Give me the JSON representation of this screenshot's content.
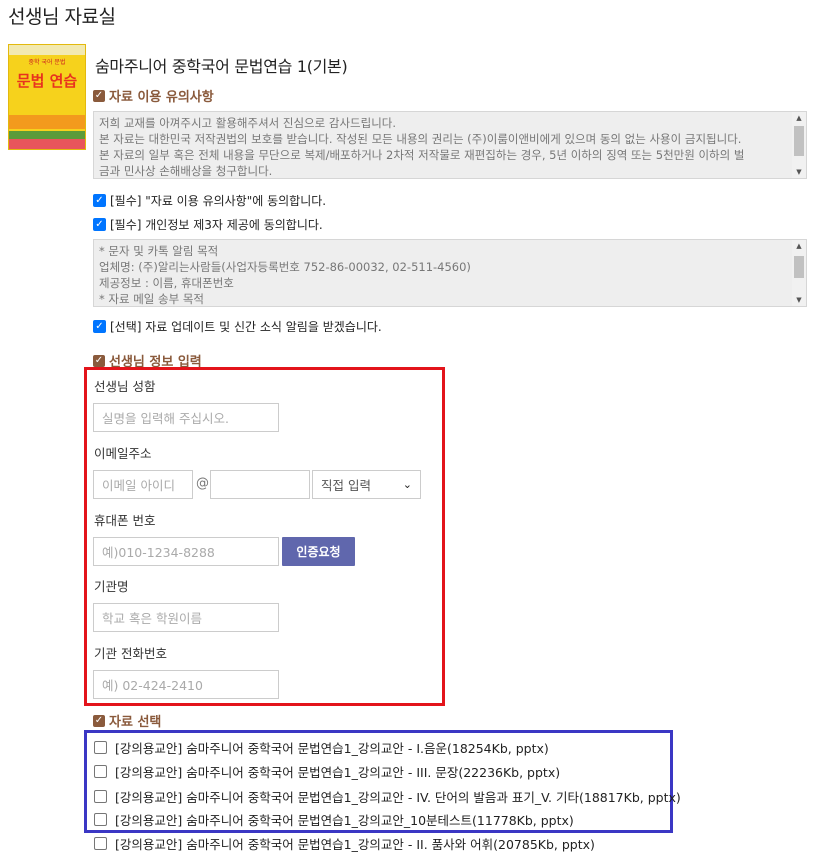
{
  "page": {
    "title": "선생님 자료실"
  },
  "book": {
    "title": "숨마주니어 중학국어 문법연습 1(기본)",
    "cover_top_text": "중학 국어 문법",
    "cover_line": "문법 연습"
  },
  "notice": {
    "header": "자료 이용 유의사항",
    "lines": [
      "저희 교재를 아껴주시고 활용해주셔서 진심으로 감사드립니다.",
      "본 자료는 대한민국 저작권법의 보호를 받습니다. 작성된 모든 내용의 권리는 (주)이룸이앤비에게 있으며 동의 없는 사용이 금지됩니다.",
      "본 자료의 일부 혹은 전체 내용을 무단으로 복제/배포하거나 2차적 저작물로 재편집하는 경우, 5년 이하의 징역 또는 5천만원 이하의 벌",
      "금과 민사상 손해배상을 청구합니다."
    ]
  },
  "agreements": {
    "required_notice": "[필수] \"자료 이용 유의사항\"에 동의합니다.",
    "required_privacy": "[필수] 개인정보 제3자 제공에 동의합니다.",
    "optional_updates": "[선택] 자료 업데이트 및 신간 소식 알림을 받겠습니다."
  },
  "privacy_box": {
    "lines": [
      "* 문자 및 카톡 알림 목적",
      "업체명: (주)알리는사람들(사업자등록번호 752-86-00032, 02-511-4560)",
      "제공정보 : 이름, 휴대폰번호",
      "* 자료 메일 송부 목적"
    ]
  },
  "teacher_info": {
    "header": "선생님 정보 입력",
    "name_label": "선생님 성함",
    "name_placeholder": "실명을 입력해 주십시오.",
    "email_label": "이메일주소",
    "email_id_placeholder": "이메일 아이디",
    "at_sign": "@",
    "email_domain_value": "",
    "email_domain_select": "직접 입력",
    "phone_label": "휴대폰 번호",
    "phone_placeholder": "예)010-1234-8288",
    "verify_button": "인증요청",
    "org_label": "기관명",
    "org_placeholder": "학교 혹은 학원이름",
    "org_phone_label": "기관 전화번호",
    "org_phone_placeholder": "예) 02-424-2410"
  },
  "materials": {
    "header": "자료 선택",
    "items": [
      "[강의용교안] 숨마주니어 중학국어 문법연습1_강의교안 - I.음운(18254Kb, pptx)",
      "[강의용교안] 숨마주니어 중학국어 문법연습1_강의교안 - III. 문장(22236Kb, pptx)",
      "[강의용교안] 숨마주니어 중학국어 문법연습1_강의교안 - IV. 단어의 발음과 표기_V. 기타(18817Kb, pptx)",
      "[강의용교안] 숨마주니어 중학국어 문법연습1_강의교안_10분테스트(11778Kb, pptx)",
      "[강의용교안] 숨마주니어 중학국어 문법연습1_강의교안 - II. 품사와 어휘(20785Kb, pptx)"
    ]
  },
  "colors": {
    "accent_brown": "#8a5a3c",
    "checkbox_blue": "#0075ff",
    "highlight_red": "#e3141b",
    "highlight_blue": "#3b37c4",
    "verify_button": "#6067ad"
  }
}
